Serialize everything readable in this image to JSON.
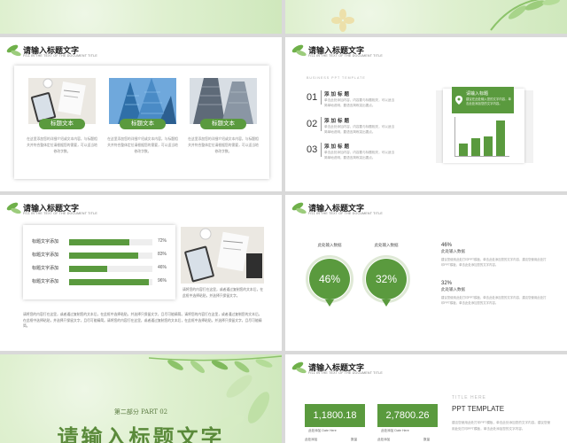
{
  "slides": {
    "common": {
      "title": "请输入标题文字",
      "subtitle": "FILL IN THE TEXT OF THE DOCUMENT TITLE"
    },
    "s1": {
      "cards": [
        {
          "label": "标题文本",
          "desc": "在这里添加您的详细介绍或文本内容，与标题相关并符合整体定位请根据您的需要，可以适当地修改字数。"
        },
        {
          "label": "标题文本",
          "desc": "在这里添加您的详细介绍或文本内容，与标题相关并符合整体定位请根据您的需要，可以适当地修改字数。"
        },
        {
          "label": "标题文本",
          "desc": "在这里添加您的详细介绍或文本内容，与标题相关并符合整体定位请根据您的需要，可以适当地修改字数。"
        }
      ]
    },
    "s2": {
      "template_label": "BUSINESS PPT TEMPLATE",
      "items": [
        {
          "num": "01",
          "title": "添加标题",
          "desc": "单击此处添加内容，内容要与标题相关，可以适当简单地说明，要语言简练突出要点。"
        },
        {
          "num": "02",
          "title": "添加标题",
          "desc": "单击此处添加内容，内容要与标题相关，可以适当简单地说明，要语言简练突出要点。"
        },
        {
          "num": "03",
          "title": "添加标题",
          "desc": "单击此处添加内容，内容要与标题相关，可以适当简单地说明，要语言简练突出要点。"
        }
      ],
      "callout_title": "请输入标题",
      "callout_desc": "建议在此处输入您的文字内容，单击此处添加您的文字内容。",
      "bars": [
        0.35,
        0.5,
        0.55,
        1.0
      ]
    },
    "s3": {
      "rows": [
        {
          "label": "标题文字添加",
          "value": 0.72,
          "text": "72%"
        },
        {
          "label": "标题文字添加",
          "value": 0.83,
          "text": "83%"
        },
        {
          "label": "标题文字添加",
          "value": 0.46,
          "text": "46%"
        },
        {
          "label": "标题文字添加",
          "value": 0.96,
          "text": "96%"
        }
      ],
      "photo_desc": "请将您的内容打在这里，或者通过复制您的文本后，在此框中选择粘贴，并选择只保留文字。",
      "body": "请将您的内容打在这里，或者通过复制您的文本后，在此框中选择粘贴，并选择只保留文字，且尽可能精简。请将您的内容打在这里，或者通过复制您的文本后，在此框中选择粘贴，并选择只保留文字，且尽可能精简。请将您的内容打在这里，或者通过复制您的文本后，在此框中选择粘贴，并选择只保留文字，且尽可能精简。"
    },
    "s4": {
      "bubbles": [
        {
          "title": "此处输入数据",
          "value": "46%"
        },
        {
          "title": "此处输入数据",
          "value": "32%"
        }
      ],
      "stats": [
        {
          "num": "46%",
          "label": "此处输入数据",
          "desc": "建议您使用此处打印PPT模板，单击此处添加您的文字内容，建议您使用此处打印PPT模板，单击此处添加您的文字内容。"
        },
        {
          "num": "32%",
          "label": "此处输入数据",
          "desc": "建议您使用此处打印PPT模板，单击此处添加您的文字内容，建议您使用此处打印PPT模板，单击此处添加您的文字内容。"
        }
      ]
    },
    "s5": {
      "part": "第二部分 PART 02",
      "title": "请输入标题文字"
    },
    "s6": {
      "boxes": [
        {
          "value": "1,1800.18",
          "sub": "此处添加 Date Here"
        },
        {
          "value": "2,7800.26",
          "sub": "此处添加 Date Here"
        }
      ],
      "title_here": "TITLE HERE",
      "ppt_template": "PPT TEMPLATE",
      "desc": "建议您使用此处打印PPT模板，单击此处添加您的文字内容。建议您使用此处打印PPT模板，单击此处添加您的文字内容。",
      "foot_labels": [
        "此处添加",
        "数量",
        "此处添加",
        "数量"
      ]
    }
  },
  "colors": {
    "accent": "#5a9a3e",
    "light": "#dff0d0"
  }
}
